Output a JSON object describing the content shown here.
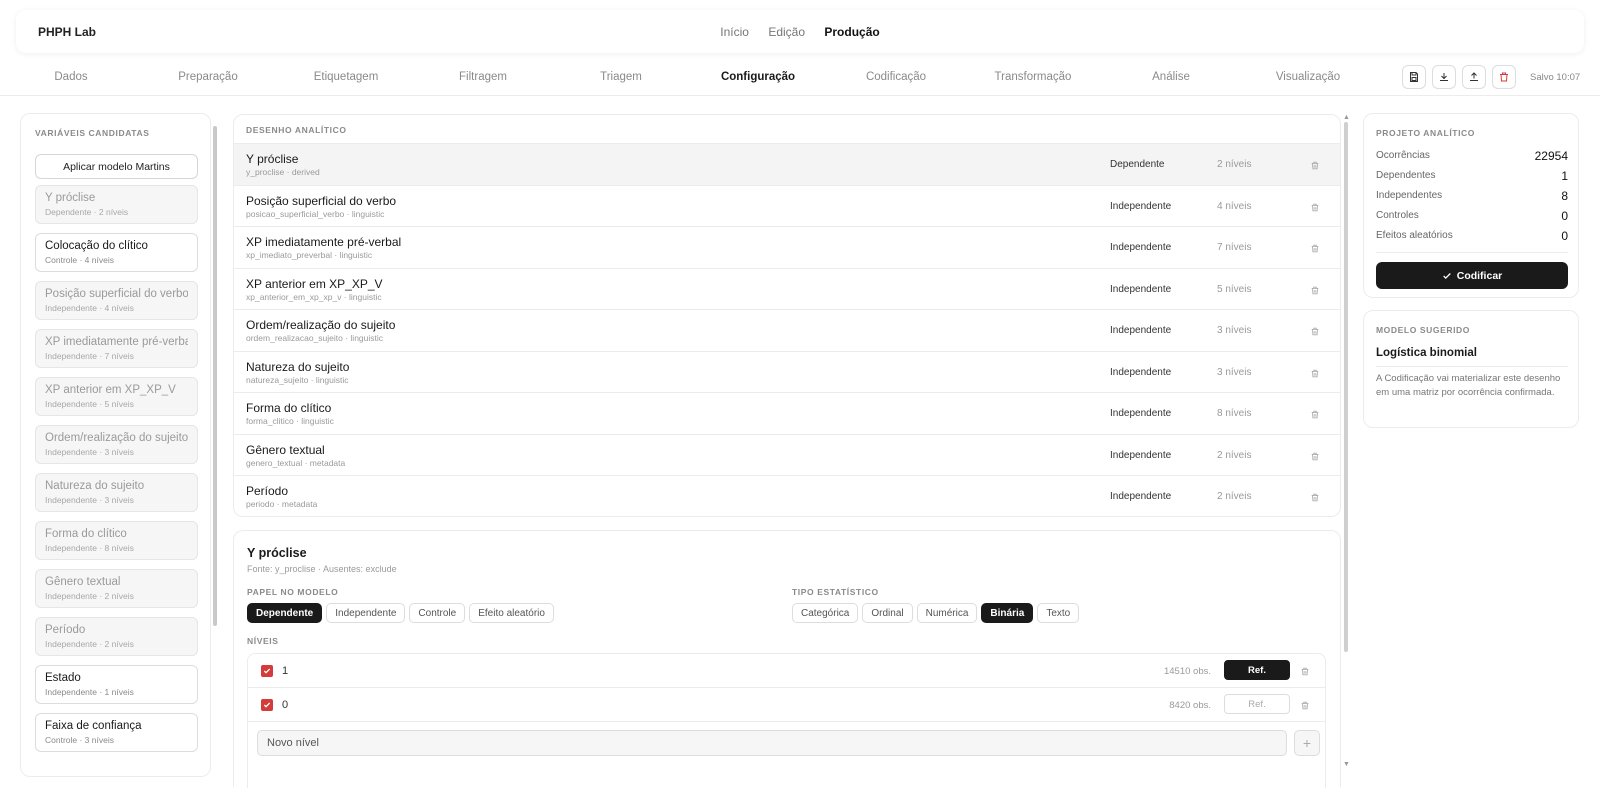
{
  "app": {
    "brand": "PHPH Lab"
  },
  "topnav": [
    {
      "label": "Início",
      "active": false
    },
    {
      "label": "Edição",
      "active": false
    },
    {
      "label": "Produção",
      "active": true
    }
  ],
  "stages": [
    {
      "label": "Dados",
      "active": false
    },
    {
      "label": "Preparação",
      "active": false
    },
    {
      "label": "Etiquetagem",
      "active": false
    },
    {
      "label": "Filtragem",
      "active": false
    },
    {
      "label": "Triagem",
      "active": false
    },
    {
      "label": "Configuração",
      "active": true
    },
    {
      "label": "Codificação",
      "active": false
    },
    {
      "label": "Transformação",
      "active": false
    },
    {
      "label": "Análise",
      "active": false
    },
    {
      "label": "Visualização",
      "active": false
    }
  ],
  "toolbar": {
    "icons": [
      "save-icon",
      "download-icon",
      "upload-icon",
      "trash-icon"
    ],
    "saved": "Salvo 10:07"
  },
  "candidates": {
    "title": "VARIÁVEIS CANDIDATAS",
    "apply_label": "Aplicar modelo Martins",
    "items": [
      {
        "name": "Y próclise",
        "meta": "Dependente · 2 níveis",
        "used": true
      },
      {
        "name": "Colocação do clítico",
        "meta": "Controle · 4 níveis",
        "used": false
      },
      {
        "name": "Posição superficial do verbo",
        "meta": "Independente · 4 níveis",
        "used": true
      },
      {
        "name": "XP imediatamente pré-verbal",
        "meta": "Independente · 7 níveis",
        "used": true
      },
      {
        "name": "XP anterior em XP_XP_V",
        "meta": "Independente · 5 níveis",
        "used": true
      },
      {
        "name": "Ordem/realização do sujeito",
        "meta": "Independente · 3 níveis",
        "used": true
      },
      {
        "name": "Natureza do sujeito",
        "meta": "Independente · 3 níveis",
        "used": true
      },
      {
        "name": "Forma do clítico",
        "meta": "Independente · 8 níveis",
        "used": true
      },
      {
        "name": "Gênero textual",
        "meta": "Independente · 2 níveis",
        "used": true
      },
      {
        "name": "Período",
        "meta": "Independente · 2 níveis",
        "used": true
      },
      {
        "name": "Estado",
        "meta": "Independente · 1 níveis",
        "used": false
      },
      {
        "name": "Faixa de confiança",
        "meta": "Controle · 3 níveis",
        "used": false
      }
    ]
  },
  "design": {
    "title": "DESENHO ANALÍTICO",
    "rows": [
      {
        "name": "Y próclise",
        "code": "y_proclise · derived",
        "role": "Dependente",
        "levels": "2 níveis",
        "selected": true
      },
      {
        "name": "Posição superficial do verbo",
        "code": "posicao_superficial_verbo · linguistic",
        "role": "Independente",
        "levels": "4 níveis",
        "selected": false
      },
      {
        "name": "XP imediatamente pré-verbal",
        "code": "xp_imediato_preverbal · linguistic",
        "role": "Independente",
        "levels": "7 níveis",
        "selected": false
      },
      {
        "name": "XP anterior em XP_XP_V",
        "code": "xp_anterior_em_xp_xp_v · linguistic",
        "role": "Independente",
        "levels": "5 níveis",
        "selected": false
      },
      {
        "name": "Ordem/realização do sujeito",
        "code": "ordem_realizacao_sujeito · linguistic",
        "role": "Independente",
        "levels": "3 níveis",
        "selected": false
      },
      {
        "name": "Natureza do sujeito",
        "code": "natureza_sujeito · linguistic",
        "role": "Independente",
        "levels": "3 níveis",
        "selected": false
      },
      {
        "name": "Forma do clítico",
        "code": "forma_clitico · linguistic",
        "role": "Independente",
        "levels": "8 níveis",
        "selected": false
      },
      {
        "name": "Gênero textual",
        "code": "genero_textual · metadata",
        "role": "Independente",
        "levels": "2 níveis",
        "selected": false
      },
      {
        "name": "Período",
        "code": "periodo · metadata",
        "role": "Independente",
        "levels": "2 níveis",
        "selected": false
      }
    ]
  },
  "detail": {
    "title": "Y próclise",
    "subtitle": "Fonte: y_proclise · Ausentes: exclude",
    "role_label": "PAPEL NO MODELO",
    "roles": [
      {
        "label": "Dependente",
        "active": true
      },
      {
        "label": "Independente",
        "active": false
      },
      {
        "label": "Controle",
        "active": false
      },
      {
        "label": "Efeito aleatório",
        "active": false
      }
    ],
    "type_label": "TIPO ESTATÍSTICO",
    "types": [
      {
        "label": "Categórica",
        "active": false
      },
      {
        "label": "Ordinal",
        "active": false
      },
      {
        "label": "Numérica",
        "active": false
      },
      {
        "label": "Binária",
        "active": true
      },
      {
        "label": "Texto",
        "active": false
      }
    ],
    "levels_label": "NÍVEIS",
    "levels": [
      {
        "value": "1",
        "obs": "14510 obs.",
        "ref_label": "Ref.",
        "is_ref": true,
        "checked": true
      },
      {
        "value": "0",
        "obs": "8420 obs.",
        "ref_label": "Ref.",
        "is_ref": false,
        "checked": true
      }
    ],
    "new_level_placeholder": "Novo nível",
    "add_label": "+"
  },
  "project": {
    "title": "PROJETO ANALÍTICO",
    "stats": [
      {
        "label": "Ocorrências",
        "value": "22954"
      },
      {
        "label": "Dependentes",
        "value": "1"
      },
      {
        "label": "Independentes",
        "value": "8"
      },
      {
        "label": "Controles",
        "value": "0"
      },
      {
        "label": "Efeitos aleatórios",
        "value": "0"
      }
    ],
    "button_label": "Codificar"
  },
  "model": {
    "title": "MODELO SUGERIDO",
    "name": "Logística binomial",
    "description": "A Codificação vai materializar este desenho em uma matriz por ocorrência confirmada."
  },
  "colors": {
    "accent": "#1a1a1a",
    "danger": "#d43b3b",
    "muted": "#8a8a8a"
  }
}
